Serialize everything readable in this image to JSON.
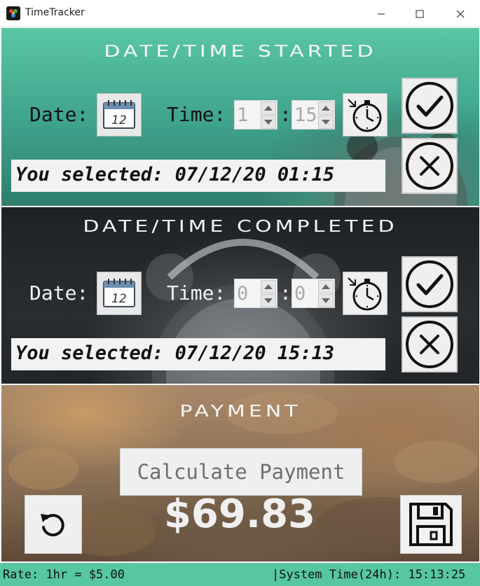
{
  "window": {
    "title": "TimeTracker"
  },
  "started": {
    "heading": "DATE/TIME STARTED",
    "date_label": "Date:",
    "time_label": "Time:",
    "hour": "1",
    "colon": ":",
    "minute": "15",
    "selected_text": "You selected: 07/12/20 01:15"
  },
  "completed": {
    "heading": "DATE/TIME COMPLETED",
    "date_label": "Date:",
    "time_label": "Time:",
    "hour": "0",
    "colon": ":",
    "minute": "0",
    "selected_text": "You selected: 07/12/20 15:13"
  },
  "payment": {
    "heading": "PAYMENT",
    "calculate_label": "Calculate Payment",
    "amount": "$69.83"
  },
  "status": {
    "rate": "Rate: 1hr = $5.00",
    "system_time": "|System Time(24h): 15:13:25"
  },
  "icons": {
    "calendar_number": "12"
  },
  "colors": {
    "status_bar": "#57c7a1",
    "started_panel": "#4fb897",
    "completed_panel": "#23272a",
    "payment_panel": "#8d7257"
  }
}
